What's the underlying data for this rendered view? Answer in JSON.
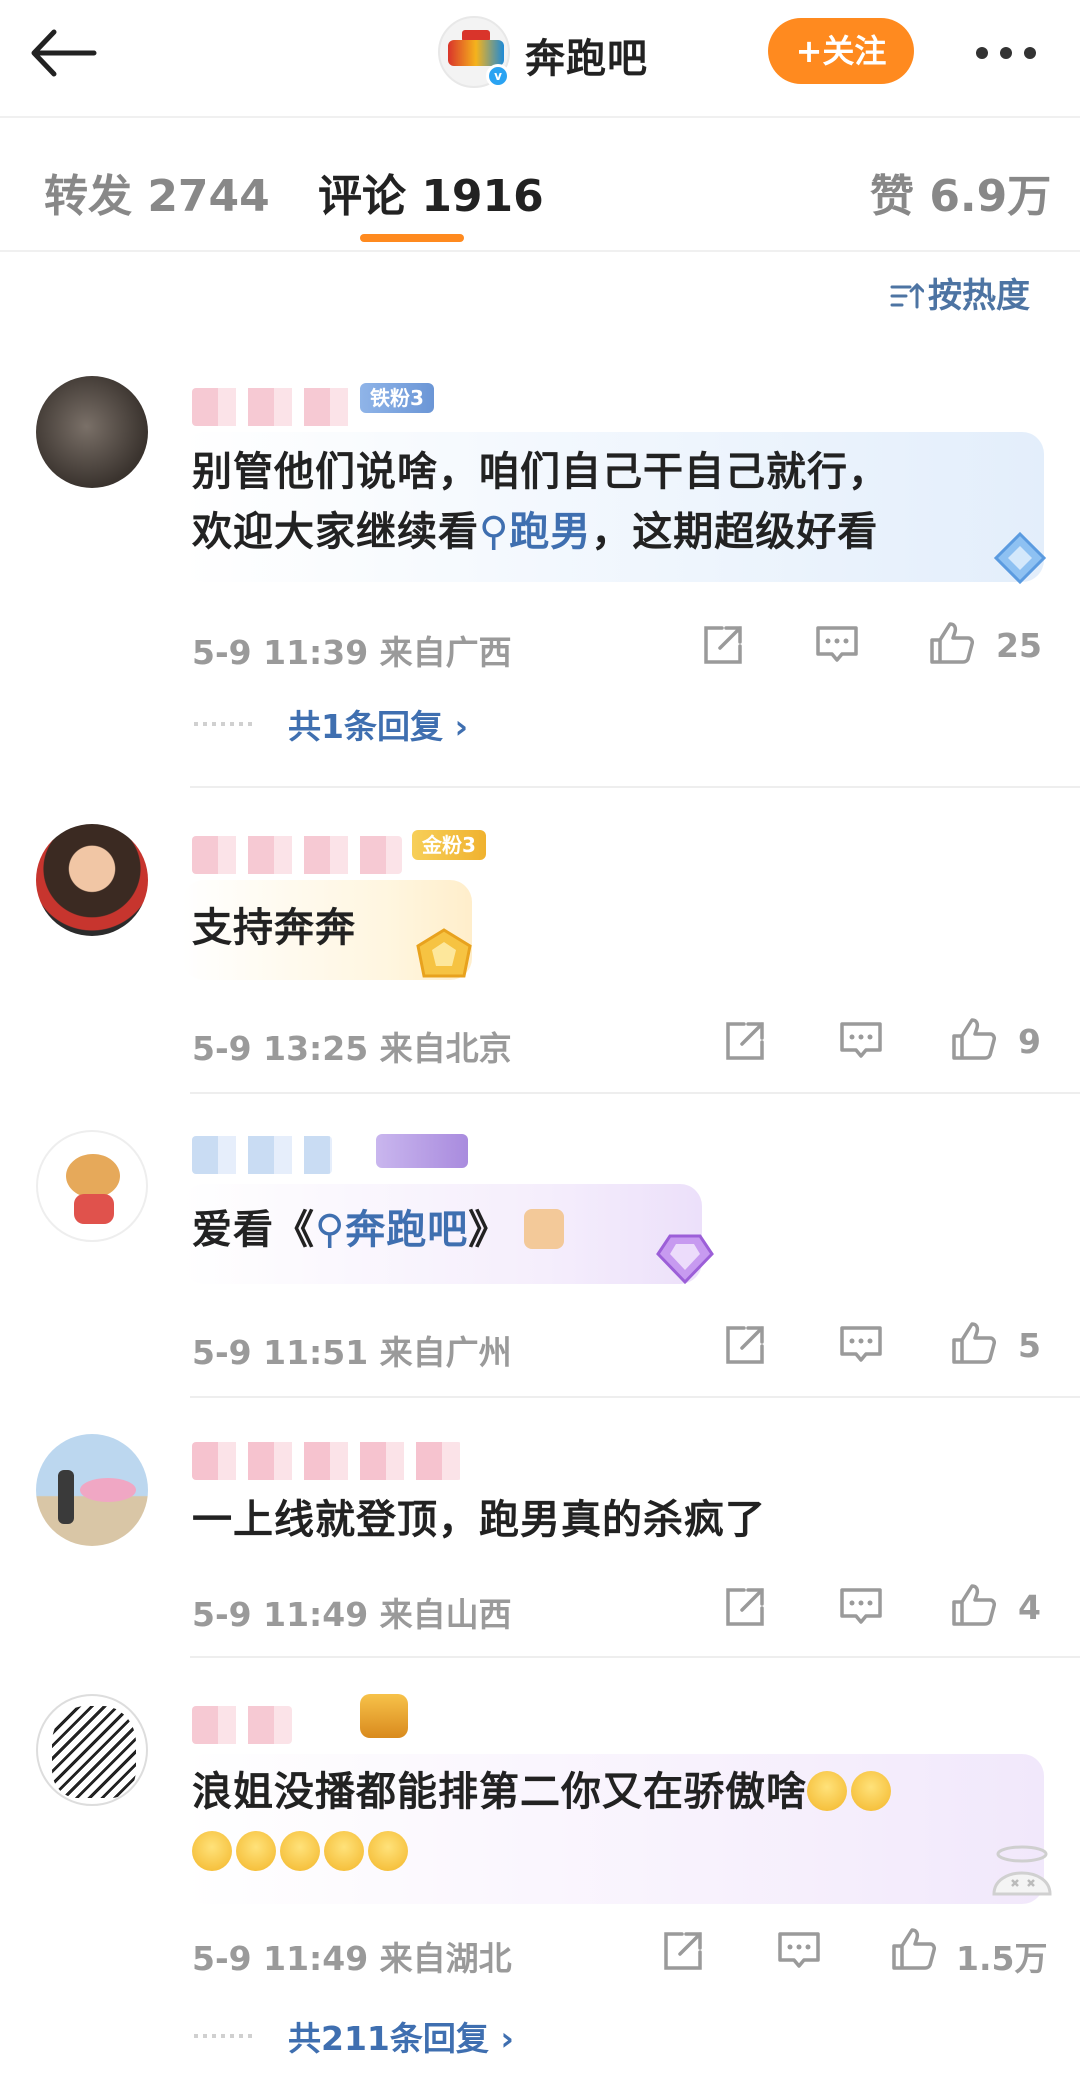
{
  "header": {
    "account_name": "奔跑吧",
    "follow_label": "+关注",
    "verified_mark": "v"
  },
  "tabs": [
    {
      "label": "转发 2744"
    },
    {
      "label": "评论 1916"
    },
    {
      "label": "赞 6.9万"
    }
  ],
  "sort": {
    "label": "按热度"
  },
  "comments": [
    {
      "badge": "铁粉3",
      "text_line1": "别管他们说啥，咱们自己干自己就行，",
      "text_line2_pre": "欢迎大家继续看",
      "topic": "跑男",
      "text_line2_post": "，这期超级好看",
      "time": "5-9 11:39",
      "location": "来自广西",
      "likes": "25",
      "reply_label": "共1条回复 ›"
    },
    {
      "badge": "金粉3",
      "text_line1": "支持奔奔",
      "time": "5-9 13:25",
      "location": "来自北京",
      "likes": "9"
    },
    {
      "text_pre": "爱看《",
      "topic": "奔跑吧",
      "text_post": "》",
      "time": "5-9 11:51",
      "location": "来自广州",
      "likes": "5"
    },
    {
      "text_line1": "一上线就登顶，跑男真的杀疯了",
      "time": "5-9 11:49",
      "location": "来自山西",
      "likes": "4"
    },
    {
      "text_line1": "浪姐没播都能排第二你又在骄傲啥",
      "time": "5-9 11:49",
      "location": "来自湖北",
      "likes": "1.5万",
      "reply_label": "共211条回复 ›"
    }
  ],
  "colors": {
    "accent": "#ff8a1f",
    "link": "#3f6fb0",
    "meta": "#9a9a9a"
  }
}
